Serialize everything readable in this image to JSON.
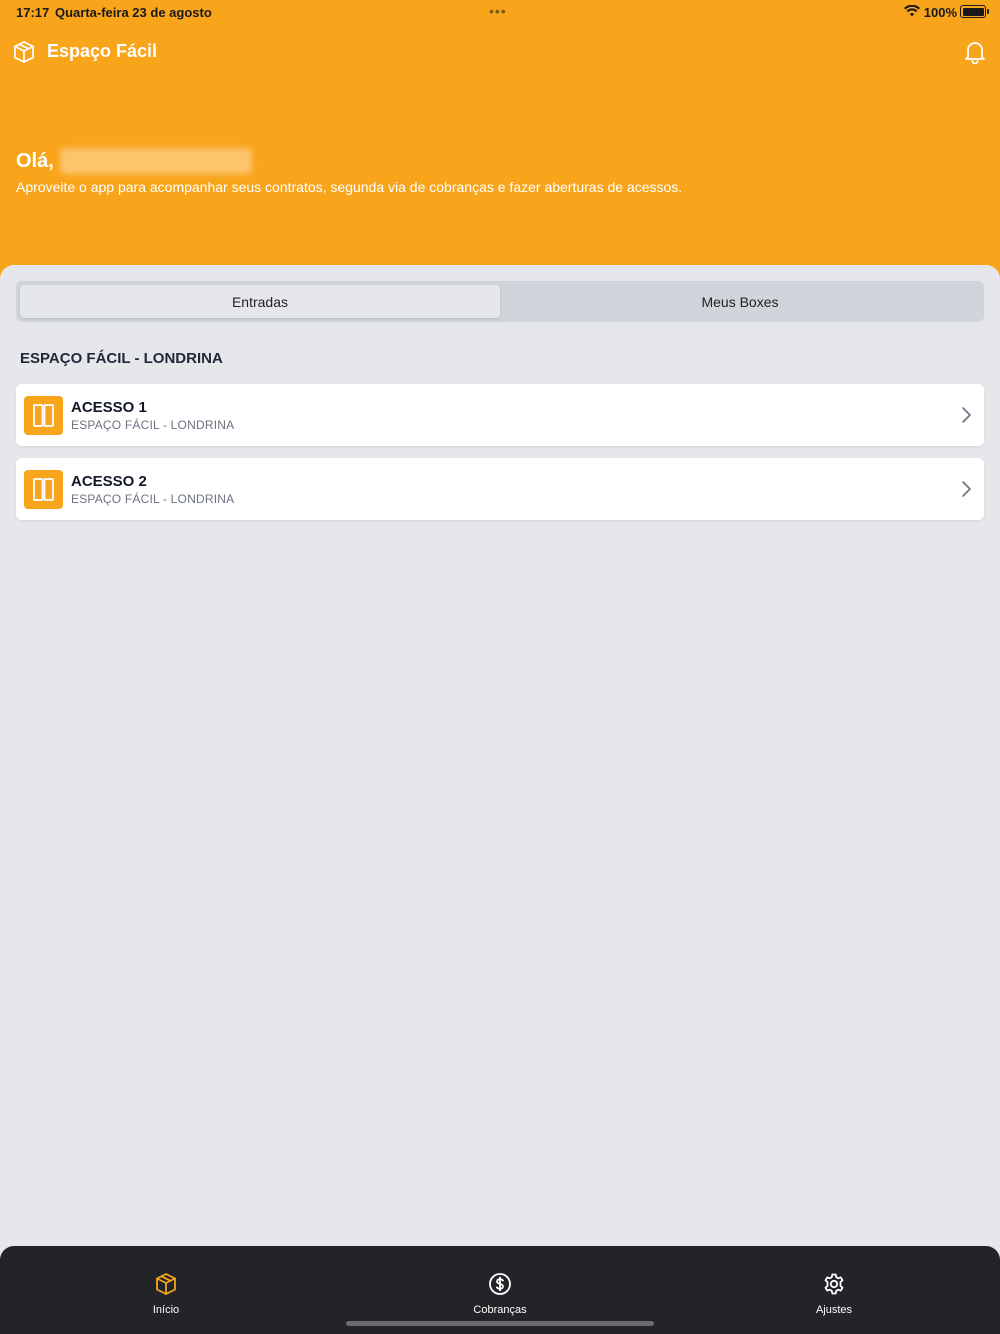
{
  "status_bar": {
    "time": "17:17",
    "date": "Quarta-feira 23 de agosto",
    "dots": "•••",
    "battery": "100%"
  },
  "header": {
    "app_title": "Espaço Fácil",
    "logo_icon": "package-box-icon",
    "notification_icon": "bell-icon",
    "greeting": "Olá,",
    "subtitle": "Aproveite o app para acompanhar seus contratos, segunda via de cobranças e fazer aberturas de acessos."
  },
  "segmented": {
    "tabs": [
      {
        "label": "Entradas",
        "active": true
      },
      {
        "label": "Meus Boxes",
        "active": false
      }
    ]
  },
  "section": {
    "title": "ESPAÇO FÁCIL - LONDRINA",
    "items": [
      {
        "title": "ACESSO 1",
        "subtitle": "ESPAÇO FÁCIL - LONDRINA",
        "icon": "door-icon"
      },
      {
        "title": "ACESSO 2",
        "subtitle": "ESPAÇO FÁCIL - LONDRINA",
        "icon": "door-icon"
      }
    ]
  },
  "tab_bar": {
    "items": [
      {
        "label": "Início",
        "icon": "package-box-icon",
        "active": true
      },
      {
        "label": "Cobranças",
        "icon": "dollar-circle-icon",
        "active": false
      },
      {
        "label": "Ajustes",
        "icon": "gear-icon",
        "active": false
      }
    ]
  },
  "colors": {
    "brand": "#f8a51c",
    "background": "#e5e7eb",
    "tab_bar": "#222428",
    "text_primary": "#111827",
    "text_secondary": "#6b7280"
  }
}
